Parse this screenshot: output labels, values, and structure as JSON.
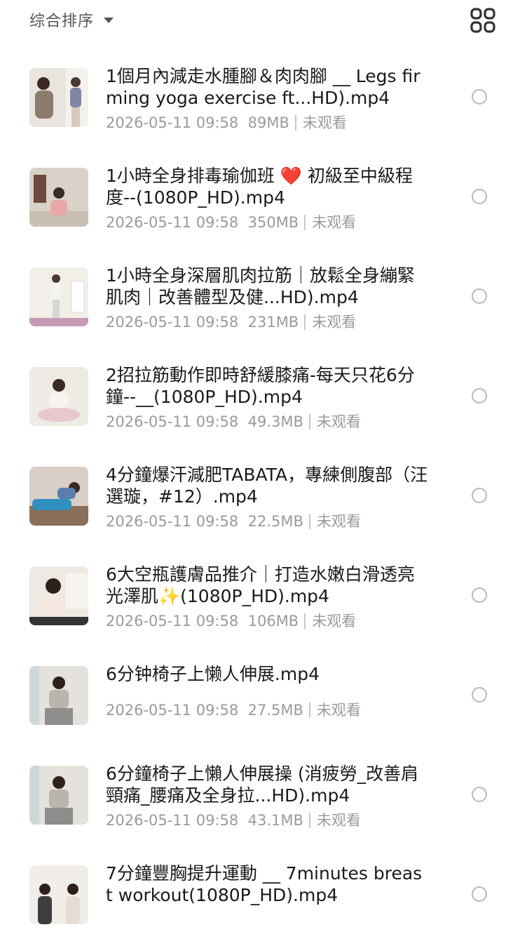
{
  "toolbar": {
    "sort_label": "综合排序",
    "sort_icon": "caret-down-icon",
    "view_icon": "grid-view-icon"
  },
  "files": [
    {
      "title": "1個月內減走水腫腳＆肉肉腳 __ Legs firming yoga exercise ft...HD).mp4",
      "date": "2026-05-11 09:58",
      "size": "89MB",
      "status": "未观看"
    },
    {
      "title": "1小時全身排毒瑜伽班 ❤️ 初級至中級程度--(1080P_HD).mp4",
      "date": "2026-05-11 09:58",
      "size": "350MB",
      "status": "未观看"
    },
    {
      "title": "1小時全身深層肌肉拉筋｜放鬆全身繃緊肌肉｜改善體型及健...HD).mp4",
      "date": "2026-05-11 09:58",
      "size": "231MB",
      "status": "未观看"
    },
    {
      "title": "2招拉筋動作即時舒緩膝痛-每天只花6分鐘--__(1080P_HD).mp4",
      "date": "2026-05-11 09:58",
      "size": "49.3MB",
      "status": "未观看"
    },
    {
      "title": "4分鐘爆汗減肥TABATA，專練側腹部（汪選璇，#12）.mp4",
      "date": "2026-05-11 09:58",
      "size": "22.5MB",
      "status": "未观看"
    },
    {
      "title": "6大空瓶護膚品推介｜打造水嫩白滑透亮光澤肌✨(1080P_HD).mp4",
      "date": "2026-05-11 09:58",
      "size": "106MB",
      "status": "未观看"
    },
    {
      "title": "6分钟椅子上懒人伸展.mp4",
      "date": "2026-05-11 09:58",
      "size": "27.5MB",
      "status": "未观看"
    },
    {
      "title": "6分鐘椅子上懶人伸展操 (消疲勞_改善肩頸痛_腰痛及全身拉...HD).mp4",
      "date": "2026-05-11 09:58",
      "size": "43.1MB",
      "status": "未观看"
    },
    {
      "title": "7分鐘豐胸提升運動 __ 7minutes breast workout(1080P_HD).mp4",
      "date": "",
      "size": "",
      "status": ""
    }
  ],
  "colors": {
    "title": "#1a1a1a",
    "meta": "#9a9a9a",
    "radio_border": "#b8b8b8",
    "background": "#ffffff"
  }
}
